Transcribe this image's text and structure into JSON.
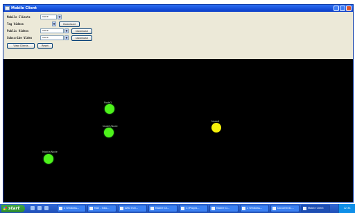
{
  "window": {
    "title": "Mobile Client"
  },
  "form": {
    "mobile_clients": {
      "label": "Mobile Clients",
      "value": "none",
      "arrow": "▼"
    },
    "tag_videos": {
      "label": "Tag Videos",
      "arrow": "▼",
      "button": "Download"
    },
    "public_videos": {
      "label": "Public Videos",
      "value": "none",
      "arrow": "▼",
      "button": "Download"
    },
    "subscribe_videos": {
      "label": "Subscribe Video",
      "value": "none",
      "arrow": "▼",
      "button": "Download"
    },
    "view_clients_button": "View Clients",
    "reset_button": "Reset"
  },
  "canvas": {
    "nodes": [
      {
        "label": "Node2",
        "color": "green"
      },
      {
        "label": "Node6",
        "color": "yellow"
      },
      {
        "label": "Node3/Node",
        "color": "green"
      },
      {
        "label": "Mobile/Node",
        "color": "green"
      }
    ]
  },
  "taskbar": {
    "start": "start",
    "tasks": [
      "2 Windows...",
      "Mail - Inbo...",
      "AMD Indi...",
      "Mobile Cli...",
      "C:\\Progra...",
      "Mobile Cl...",
      "2 Windows...",
      "Document1...",
      "Mobile Client"
    ],
    "tray": "12:34"
  }
}
